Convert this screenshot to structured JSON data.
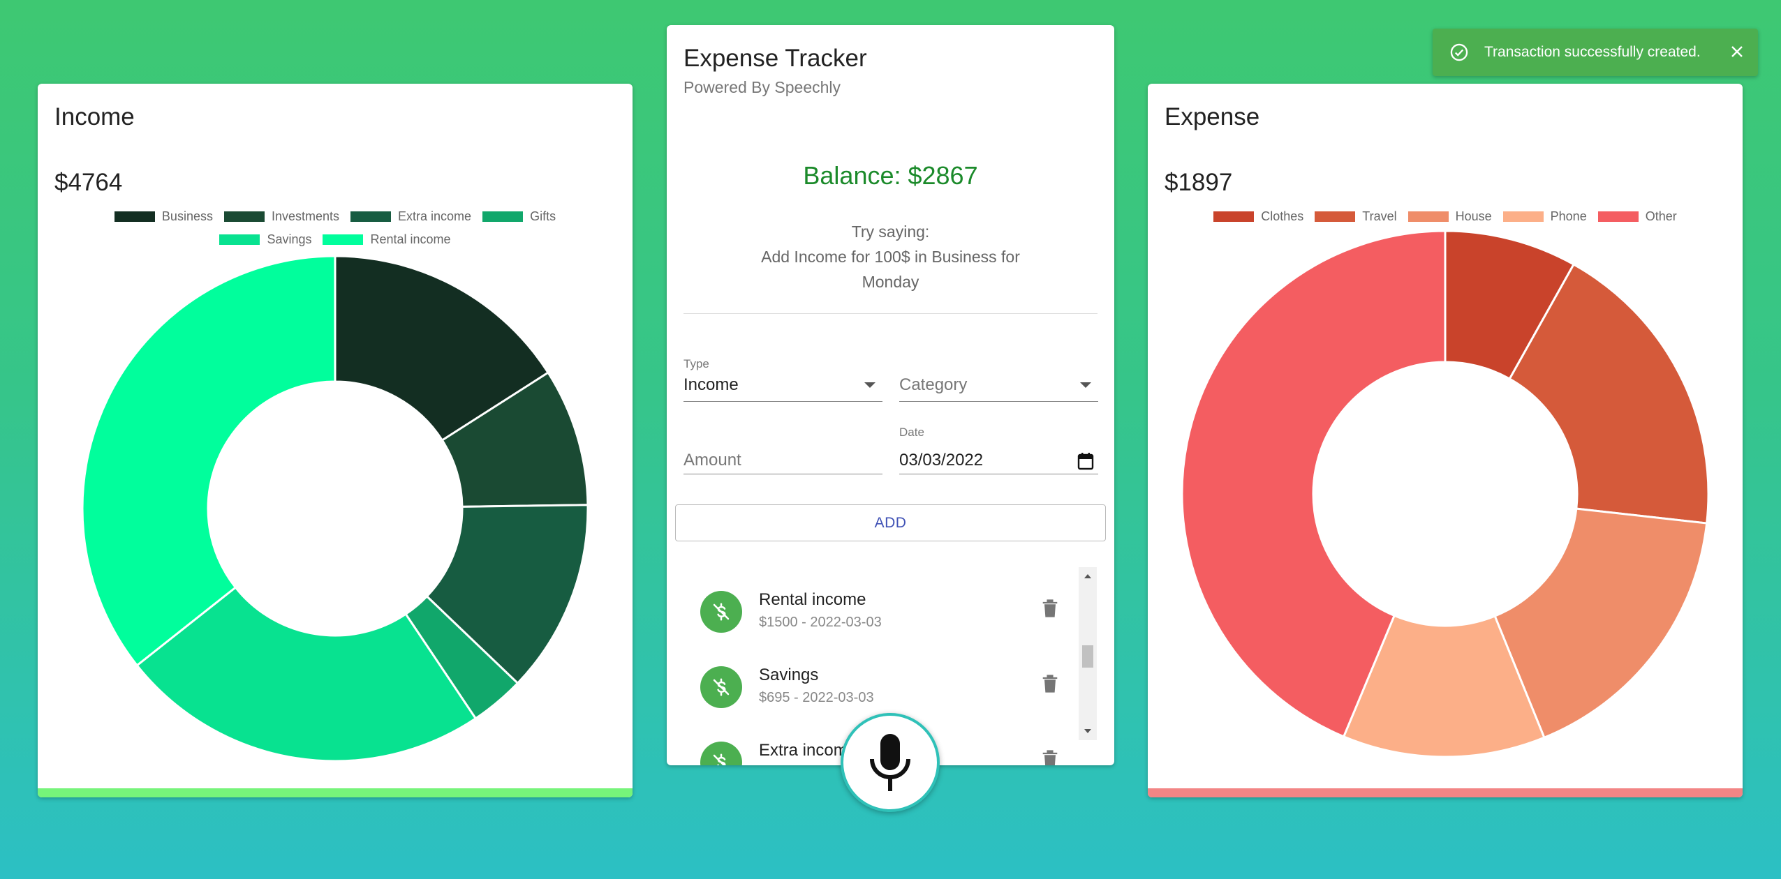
{
  "income": {
    "title": "Income",
    "total": "$4764",
    "bar_color": "#76f47a",
    "legend_rows": [
      [
        "Business",
        "Investments",
        "Extra income",
        "Gifts"
      ],
      [
        "Savings",
        "Rental income"
      ]
    ]
  },
  "expense": {
    "title": "Expense",
    "total": "$1897",
    "bar_color": "#f28585",
    "legend_rows": [
      [
        "Clothes",
        "Travel",
        "House",
        "Phone",
        "Other"
      ]
    ]
  },
  "main": {
    "title": "Expense Tracker",
    "subtitle": "Powered By Speechly",
    "balance": "Balance: $2867",
    "hint_line1": "Try saying:",
    "hint_line2": "Add Income for 100$ in Business for",
    "hint_line3": "Monday",
    "form": {
      "type_label": "Type",
      "type_value": "Income",
      "category_placeholder": "Category",
      "amount_placeholder": "Amount",
      "date_label": "Date",
      "date_value": "03/03/2022",
      "add_label": "ADD"
    },
    "transactions": [
      {
        "name": "Rental income",
        "detail": "$1500 - 2022-03-03"
      },
      {
        "name": "Savings",
        "detail": "$695 - 2022-03-03"
      },
      {
        "name": "Extra income",
        "detail": ""
      }
    ]
  },
  "toast": {
    "message": "Transaction successfully created."
  },
  "icons": {
    "mic": "microphone-icon",
    "delete": "trash-icon",
    "money": "money-off-icon",
    "calendar": "calendar-icon",
    "toast_check": "check-circle-icon",
    "toast_close": "close-icon"
  },
  "chart_data": [
    {
      "type": "pie",
      "categories": [
        "Business",
        "Investments",
        "Extra income",
        "Gifts",
        "Savings",
        "Rental income"
      ],
      "values": [
        760,
        420,
        590,
        165,
        1130,
        1699
      ],
      "colors": [
        "#132e22",
        "#1a4a33",
        "#175c41",
        "#11a76b",
        "#08e290",
        "#01fe9c"
      ]
    },
    {
      "type": "pie",
      "categories": [
        "Clothes",
        "Travel",
        "House",
        "Phone",
        "Other"
      ],
      "values": [
        154,
        354,
        324,
        236,
        829
      ],
      "colors": [
        "#c9432b",
        "#d55a3a",
        "#ef8d69",
        "#fcaf88",
        "#f45d61"
      ]
    }
  ]
}
